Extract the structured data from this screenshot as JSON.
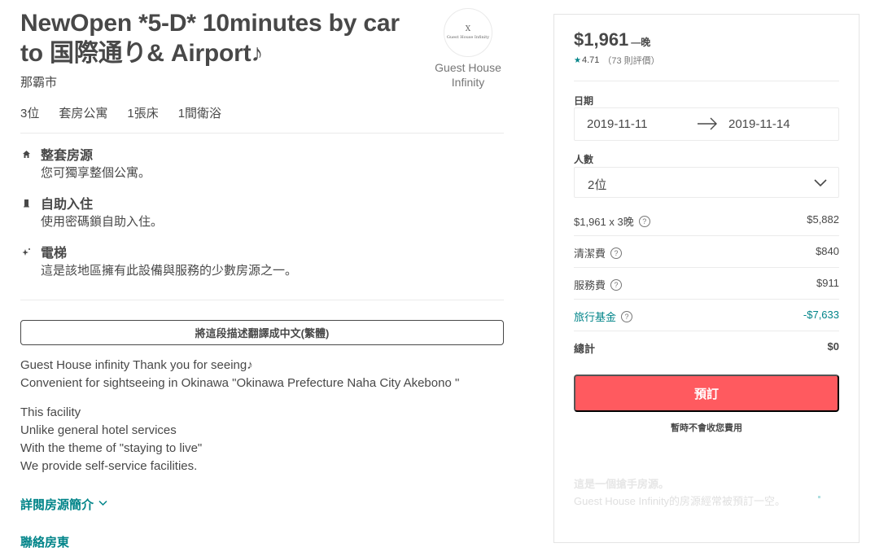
{
  "listing": {
    "title": "NewOpen *5-D* 10minutes by car to 国際通り& Airport♪",
    "city": "那霸市",
    "host": {
      "name": "Guest House Infinity",
      "logo_mark": "X",
      "logo_text": "Guest House Infinity"
    },
    "specs": [
      "3位",
      "套房公寓",
      "1張床",
      "1間衛浴"
    ],
    "amenities": [
      {
        "icon": "home-icon",
        "title": "整套房源",
        "desc": "您可獨享整個公寓。"
      },
      {
        "icon": "door-icon",
        "title": "自助入住",
        "desc": "使用密碼鎖自助入住。"
      },
      {
        "icon": "sparkle-icon",
        "title": "電梯",
        "desc": "這是該地區擁有此設備與服務的少數房源之一。"
      }
    ],
    "translate_label": "將這段描述翻譯成中文(繁體)",
    "description": [
      [
        "Guest House infinity Thank you for seeing♪",
        "Convenient for sightseeing in Okinawa \"Okinawa Prefecture Naha City Akebono \""
      ],
      [
        "This facility",
        "Unlike general hotel services",
        "With the theme of \"staying to live\"",
        "We provide self-service facilities."
      ]
    ],
    "more_label": "詳閱房源簡介",
    "contact_label": "聯絡房東"
  },
  "booking": {
    "price": "$1,961",
    "per_night": "—晚",
    "rating": "4.71",
    "reviews": "（73 則評價）",
    "date_label": "日期",
    "check_in": "2019-11-11",
    "check_out": "2019-11-14",
    "guests_label": "人數",
    "guests_value": "2位",
    "items": [
      {
        "label": "$1,961 x 3晚",
        "amount": "$5,882",
        "help": true
      },
      {
        "label": "清潔費",
        "amount": "$840",
        "help": true
      },
      {
        "label": "服務費",
        "amount": "$911",
        "help": true
      },
      {
        "label": "旅行基金",
        "amount": "-$7,633",
        "help": true
      },
      {
        "label": "總計",
        "amount": "$0",
        "help": false
      }
    ],
    "reserve_label": "預訂",
    "no_charge": "暫時不會收您費用",
    "rare_title": "這是一個搶手房源。",
    "rare_desc": "Guest House Infinity的房源經常被預訂一空。",
    "colors": {
      "brand": "#ff5a5f",
      "teal": "#008489",
      "text": "#484848"
    }
  }
}
